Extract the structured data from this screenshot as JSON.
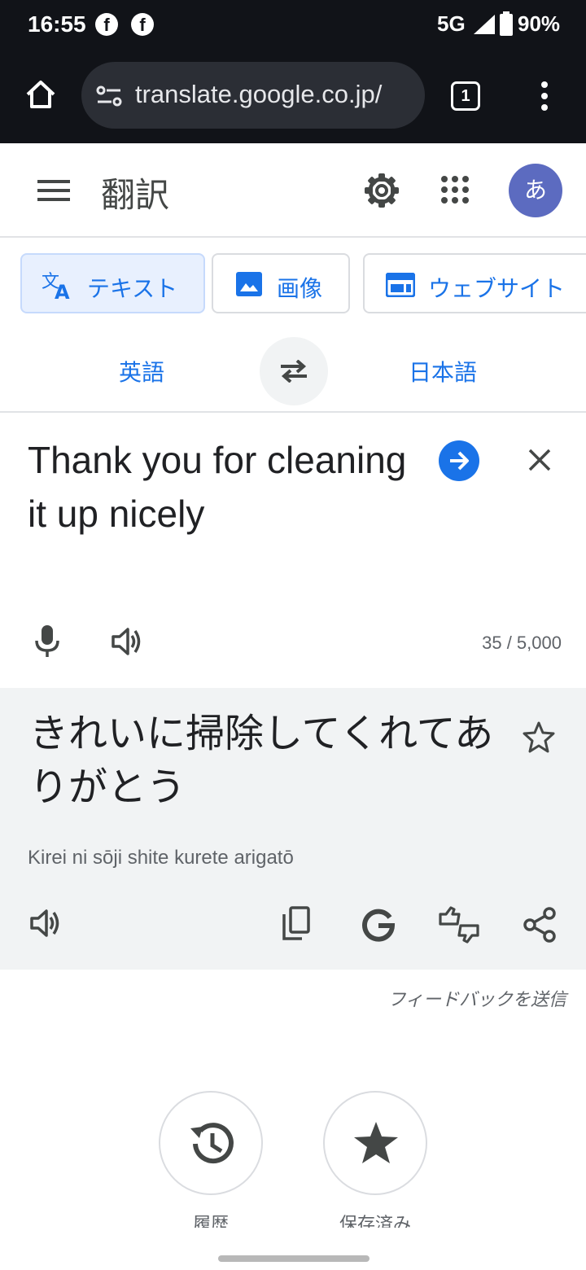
{
  "status_bar": {
    "time": "16:55",
    "network": "5G",
    "battery": "90%",
    "notification_icons": [
      "facebook-icon",
      "facebook-icon"
    ]
  },
  "browser": {
    "url": "translate.google.co.jp/",
    "tab_count": "1"
  },
  "app": {
    "title": "翻訳",
    "avatar_letter": "あ",
    "accent_color": "#1a73e8"
  },
  "modes": [
    {
      "label": "テキスト",
      "icon": "translate-icon",
      "selected": true
    },
    {
      "label": "画像",
      "icon": "image-icon",
      "selected": false
    },
    {
      "label": "ウェブサイト",
      "icon": "website-icon",
      "selected": false
    }
  ],
  "languages": {
    "source": "英語",
    "target": "日本語"
  },
  "source": {
    "text": "Thank you for cleaning it up nicely",
    "char_count": "35 / 5,000"
  },
  "result": {
    "text": "きれいに掃除してくれてありがとう",
    "transliteration": "Kirei ni sōji shite kurete arigatō"
  },
  "feedback_link": "フィードバックを送信",
  "bottom_actions": [
    {
      "label": "履歴",
      "icon": "history-icon"
    },
    {
      "label": "保存済み",
      "icon": "star-icon"
    }
  ]
}
